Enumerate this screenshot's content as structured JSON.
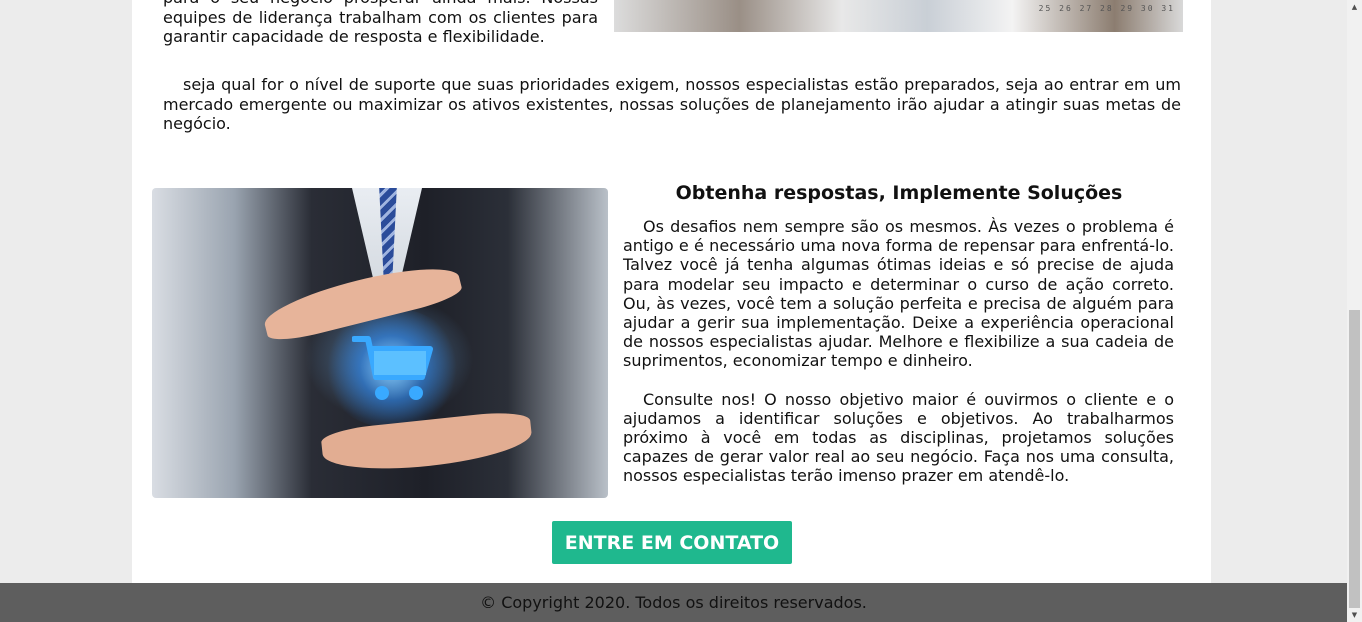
{
  "intro": {
    "text": "para o seu negócio prosperar ainda mais. Nossas equipes de liderança trabalham com os clientes para garantir capacidade de resposta e flexibilidade."
  },
  "top_photo": {
    "calendar_digits": "25 26 27 28 29 30 31"
  },
  "paragraph_full": "seja qual for o nível de suporte que suas prioridades exigem, nossos especialistas estão preparados, seja ao entrar em um mercado emergente ou maximizar os ativos existentes, nossas soluções de planejamento irão ajudar a atingir suas metas de negócio.",
  "section": {
    "title": "Obtenha respostas, Implemente Soluções",
    "paragraphs": [
      "Os desafios nem sempre são os mesmos. Às vezes o problema é antigo e é necessário uma nova forma de repensar para enfrentá-lo. Talvez você já tenha algumas ótimas ideias e só precise de ajuda para modelar seu impacto e determinar o curso de ação correto. Ou, às vezes, você tem a solução perfeita e precisa de alguém para ajudar a gerir sua implementação. Deixe a experiência operacional de nossos especialistas ajudar. Melhore e flexibilize a sua cadeia de suprimentos, economizar tempo e dinheiro.",
      "Consulte nos! O nosso objetivo maior é ouvirmos o cliente e o ajudamos a identificar soluções e objetivos. Ao trabalharmos próximo à você em todas as disciplinas, projetamos soluções capazes de gerar valor real ao seu negócio. Faça nos uma consulta, nossos especialistas terão imenso prazer em atendê-lo."
    ]
  },
  "cta": {
    "label": "ENTRE EM CONTATO",
    "color": "#1fb88e"
  },
  "footer": {
    "text": "© Copyright 2020. Todos os direitos reservados."
  }
}
